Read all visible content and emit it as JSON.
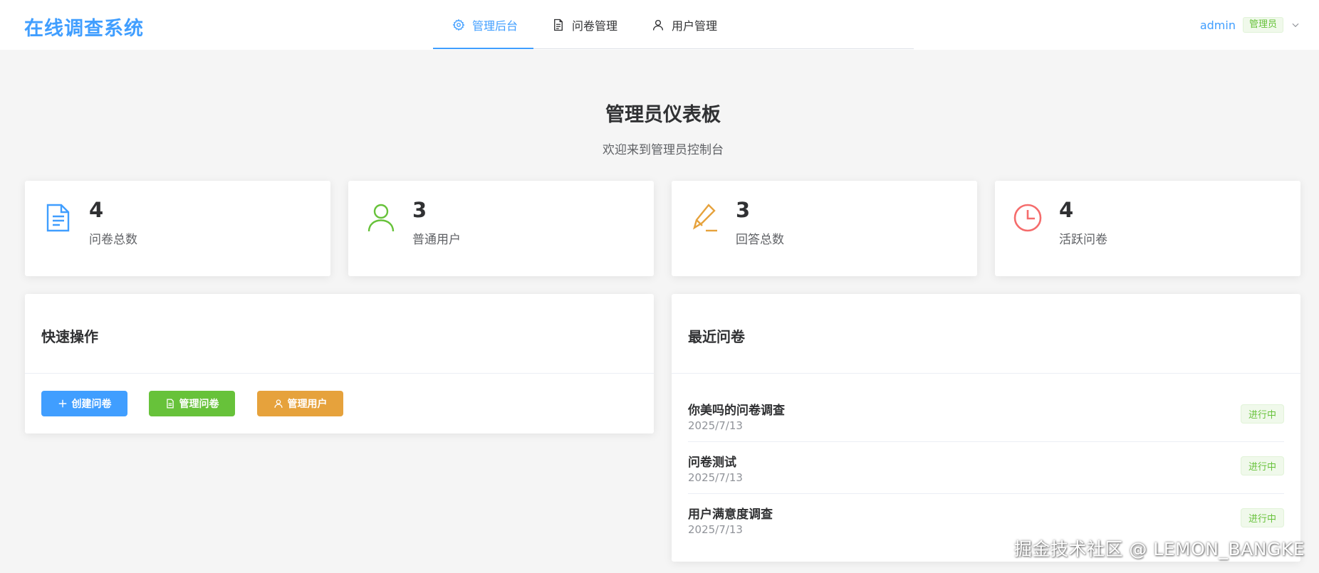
{
  "header": {
    "brand": "在线调查系统",
    "nav": [
      {
        "label": "管理后台",
        "icon": "gear-icon",
        "active": true
      },
      {
        "label": "问卷管理",
        "icon": "document-icon",
        "active": false
      },
      {
        "label": "用户管理",
        "icon": "user-icon",
        "active": false
      }
    ],
    "user": {
      "name": "admin",
      "role": "管理员",
      "icon": "chevron-down-icon"
    }
  },
  "page": {
    "title": "管理员仪表板",
    "subtitle": "欢迎来到管理员控制台"
  },
  "stats": [
    {
      "value": "4",
      "label": "问卷总数",
      "icon": "document-icon",
      "color": "#409eff"
    },
    {
      "value": "3",
      "label": "普通用户",
      "icon": "user-icon",
      "color": "#67c23a"
    },
    {
      "value": "3",
      "label": "回答总数",
      "icon": "edit-pen-icon",
      "color": "#e6a23c"
    },
    {
      "value": "4",
      "label": "活跃问卷",
      "icon": "clock-icon",
      "color": "#f56c6c"
    }
  ],
  "quick_actions": {
    "title": "快速操作",
    "buttons": [
      {
        "label": "创建问卷",
        "icon": "plus-icon",
        "color": "#409eff"
      },
      {
        "label": "管理问卷",
        "icon": "document-icon",
        "color": "#67c23a"
      },
      {
        "label": "管理用户",
        "icon": "user-icon",
        "color": "#e6a23c"
      }
    ]
  },
  "recent": {
    "title": "最近问卷",
    "items": [
      {
        "title": "你美吗的问卷调查",
        "date": "2025/7/13",
        "status": "进行中"
      },
      {
        "title": "问卷测试",
        "date": "2025/7/13",
        "status": "进行中"
      },
      {
        "title": "用户满意度调查",
        "date": "2025/7/13",
        "status": "进行中"
      }
    ]
  },
  "watermark": "掘金技术社区 @ LEMON_BANGKE",
  "colors": {
    "primary": "#409eff",
    "success": "#67c23a",
    "warning": "#e6a23c",
    "danger": "#f56c6c"
  }
}
